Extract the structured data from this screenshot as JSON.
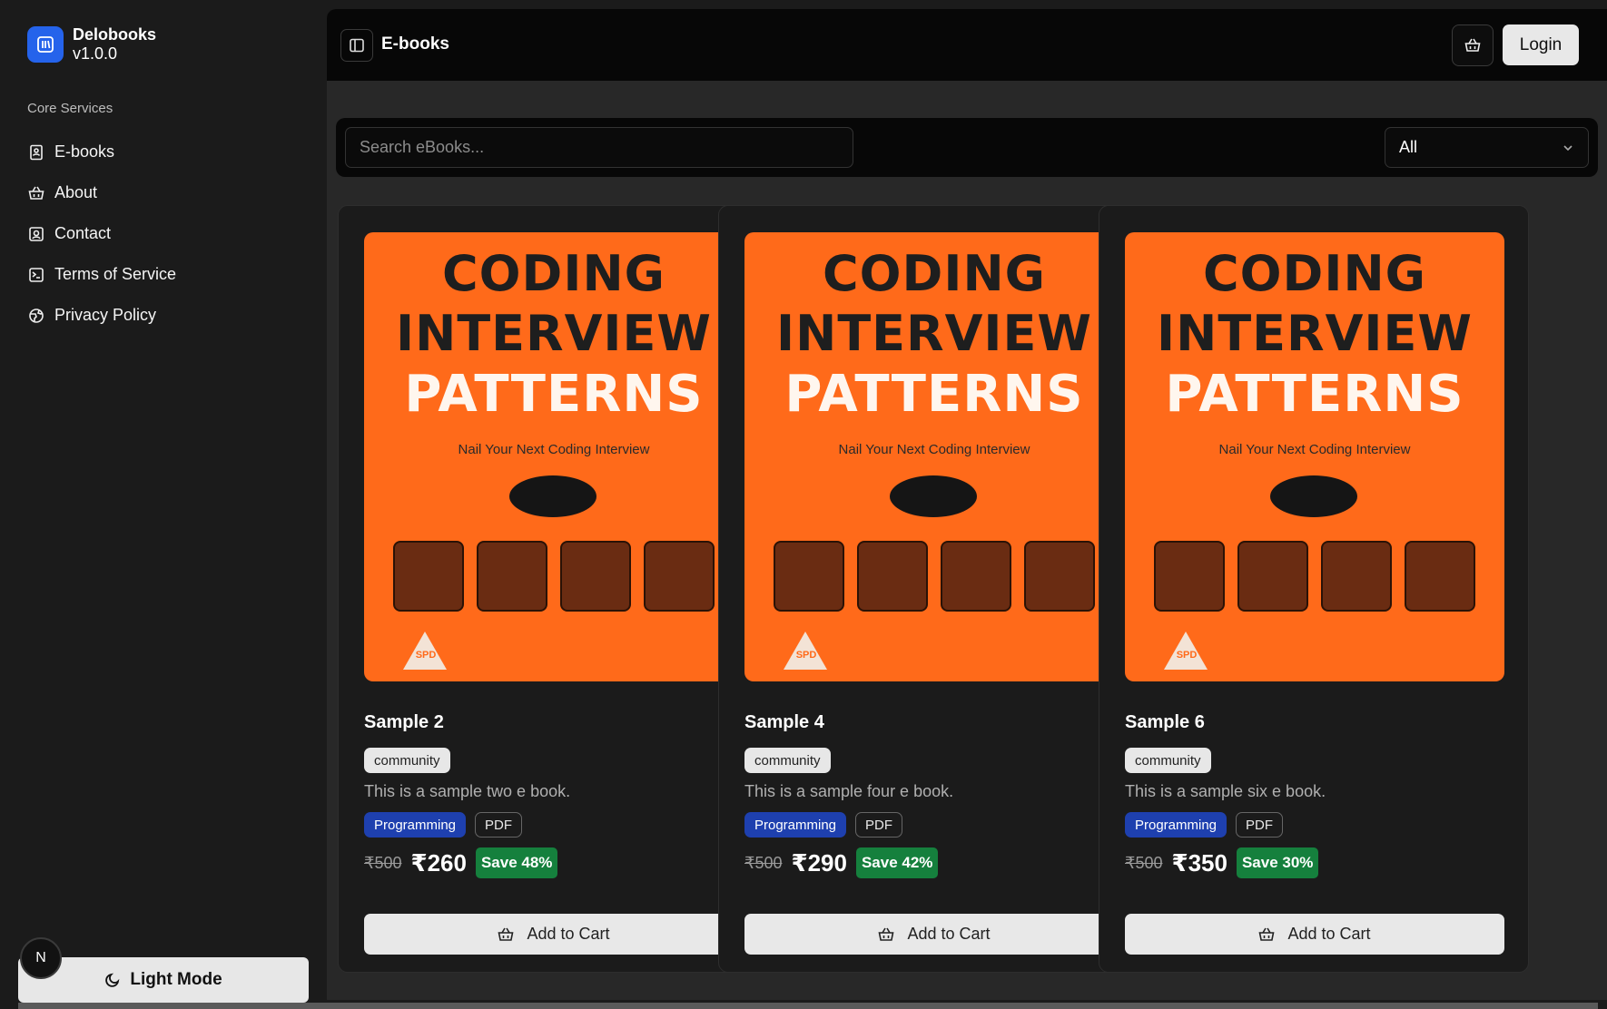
{
  "brand": {
    "name": "Delobooks",
    "version": "v1.0.0"
  },
  "sidebar": {
    "section_title": "Core Services",
    "items": [
      {
        "label": "E-books",
        "icon": "book-icon"
      },
      {
        "label": "About",
        "icon": "basket-icon"
      },
      {
        "label": "Contact",
        "icon": "contact-icon"
      },
      {
        "label": "Terms of Service",
        "icon": "terminal-icon"
      },
      {
        "label": "Privacy Policy",
        "icon": "globe-icon"
      }
    ],
    "theme_toggle_label": "Light Mode",
    "avatar_initial": "N"
  },
  "header": {
    "title": "E-books",
    "login_label": "Login"
  },
  "filter": {
    "search_placeholder": "Search eBooks...",
    "category_value": "All"
  },
  "cover": {
    "line1": "CODING",
    "line2": "INTERVIEW",
    "line3": "PATTERNS",
    "subtitle": "Nail Your Next Coding Interview",
    "publisher": "SPD"
  },
  "books": [
    {
      "title": "Sample 2",
      "source_tag": "community",
      "description": "This is a sample two e book.",
      "genre": "Programming",
      "format": "PDF",
      "old_price": "₹500",
      "price": "₹260",
      "save": "Save 48%",
      "cta": "Add to Cart"
    },
    {
      "title": "Sample 4",
      "source_tag": "community",
      "description": "This is a sample four e book.",
      "genre": "Programming",
      "format": "PDF",
      "old_price": "₹500",
      "price": "₹290",
      "save": "Save 42%",
      "cta": "Add to Cart"
    },
    {
      "title": "Sample 6",
      "source_tag": "community",
      "description": "This is a sample six e book.",
      "genre": "Programming",
      "format": "PDF",
      "old_price": "₹500",
      "price": "₹350",
      "save": "Save 30%",
      "cta": "Add to Cart"
    }
  ],
  "colors": {
    "accent": "#2563eb",
    "genre_badge": "#1e40af",
    "save_badge": "#15803d",
    "cover": "#ff6a1a"
  }
}
